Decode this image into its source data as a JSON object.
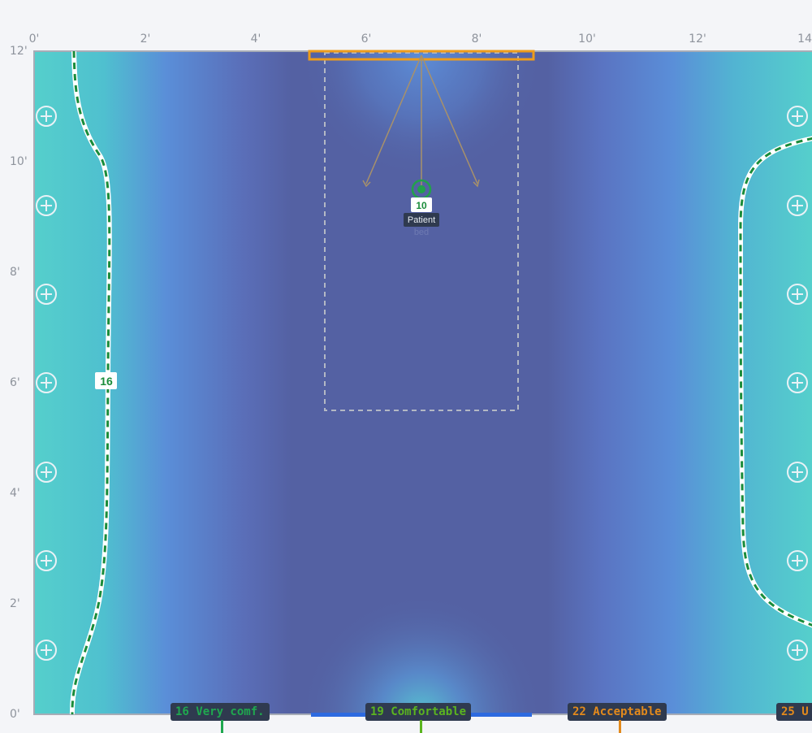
{
  "axes": {
    "x_ticks": [
      "0'",
      "2'",
      "4'",
      "6'",
      "8'",
      "10'",
      "12'",
      "14'"
    ],
    "y_ticks": [
      "12'",
      "10'",
      "8'",
      "6'",
      "4'",
      "2'",
      "0'"
    ]
  },
  "fixture": {
    "value": "10",
    "label": "Patient",
    "sublabel": "bed"
  },
  "contour": {
    "value": "16"
  },
  "legend": [
    {
      "label": "16 Very comf.",
      "color": "#1fa84f"
    },
    {
      "label": "19 Comfortable",
      "color": "#5bb51f"
    },
    {
      "label": "22 Acceptable",
      "color": "#e38a1c"
    },
    {
      "label": "25 U",
      "color": "#e38a1c"
    }
  ],
  "colors": {
    "outline": "#ee9c1a",
    "contour_green": "#1a8c3a",
    "accent_blue": "#2d6ae0",
    "heat_low": "#55c7cd",
    "heat_mid": "#5a8fd6",
    "heat_high": "#5461a3"
  },
  "icons": {
    "add_control": "plus-circle-icon",
    "fixture": "light-fixture-icon"
  }
}
